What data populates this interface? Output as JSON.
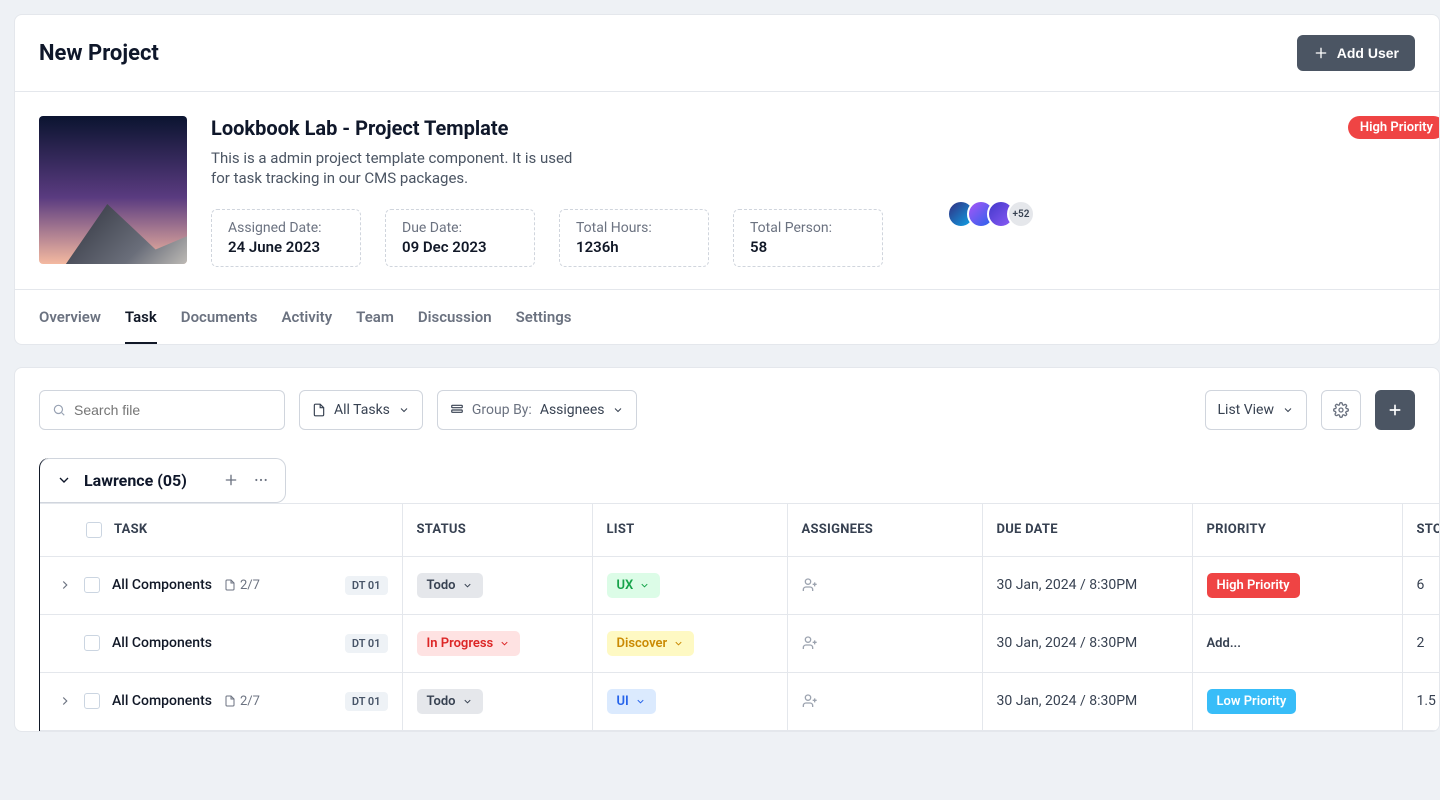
{
  "pageTitle": "New Project",
  "addUserLabel": "Add User",
  "project": {
    "name": "Lookbook Lab - Project Template",
    "description": "This is a admin project template component. It is used for task tracking in our CMS packages.",
    "priorityLabel": "High Priority",
    "avatarMore": "+52",
    "stats": [
      {
        "label": "Assigned Date:",
        "value": "24 June 2023"
      },
      {
        "label": "Due Date:",
        "value": "09 Dec 2023"
      },
      {
        "label": "Total Hours:",
        "value": "1236h"
      },
      {
        "label": "Total Person:",
        "value": "58"
      }
    ]
  },
  "tabs": [
    "Overview",
    "Task",
    "Documents",
    "Activity",
    "Team",
    "Discussion",
    "Settings"
  ],
  "activeTab": "Task",
  "toolbar": {
    "searchPlaceholder": "Search file",
    "allTasksLabel": "All Tasks",
    "groupByPrefix": "Group By: ",
    "groupByValue": "Assignees",
    "viewLabel": "List View"
  },
  "group": {
    "title": "Lawrence (05)"
  },
  "columns": {
    "task": "TASK",
    "status": "STATUS",
    "list": "LIST",
    "assignees": "ASSIGNEES",
    "due": "DUE DATE",
    "priority": "PRIORITY",
    "story": "STORY POINT"
  },
  "rows": [
    {
      "hasChevron": true,
      "name": "All Components",
      "subcount": "2/7",
      "tag": "DT 01",
      "status": {
        "text": "Todo",
        "cls": "status-todo",
        "caret": true
      },
      "list": {
        "text": "UX",
        "cls": "list-ux",
        "caret": true
      },
      "due": "30 Jan, 2024 / 8:30PM",
      "priority": {
        "text": "High Priority",
        "cls": "prio-high"
      },
      "story": "6"
    },
    {
      "hasChevron": false,
      "name": "All Components",
      "subcount": null,
      "tag": "DT 01",
      "status": {
        "text": "In Progress",
        "cls": "status-progress",
        "caret": true
      },
      "list": {
        "text": "Discover",
        "cls": "list-discover",
        "caret": true
      },
      "due": "30 Jan, 2024 / 8:30PM",
      "priority": {
        "text": "Add...",
        "cls": "prio-addlink"
      },
      "story": "2"
    },
    {
      "hasChevron": true,
      "name": "All Components",
      "subcount": "2/7",
      "tag": "DT 01",
      "status": {
        "text": "Todo",
        "cls": "status-todo",
        "caret": true
      },
      "list": {
        "text": "UI",
        "cls": "list-ui",
        "caret": true
      },
      "due": "30 Jan, 2024 / 8:30PM",
      "priority": {
        "text": "Low Priority",
        "cls": "prio-low"
      },
      "story": "1.5"
    }
  ]
}
